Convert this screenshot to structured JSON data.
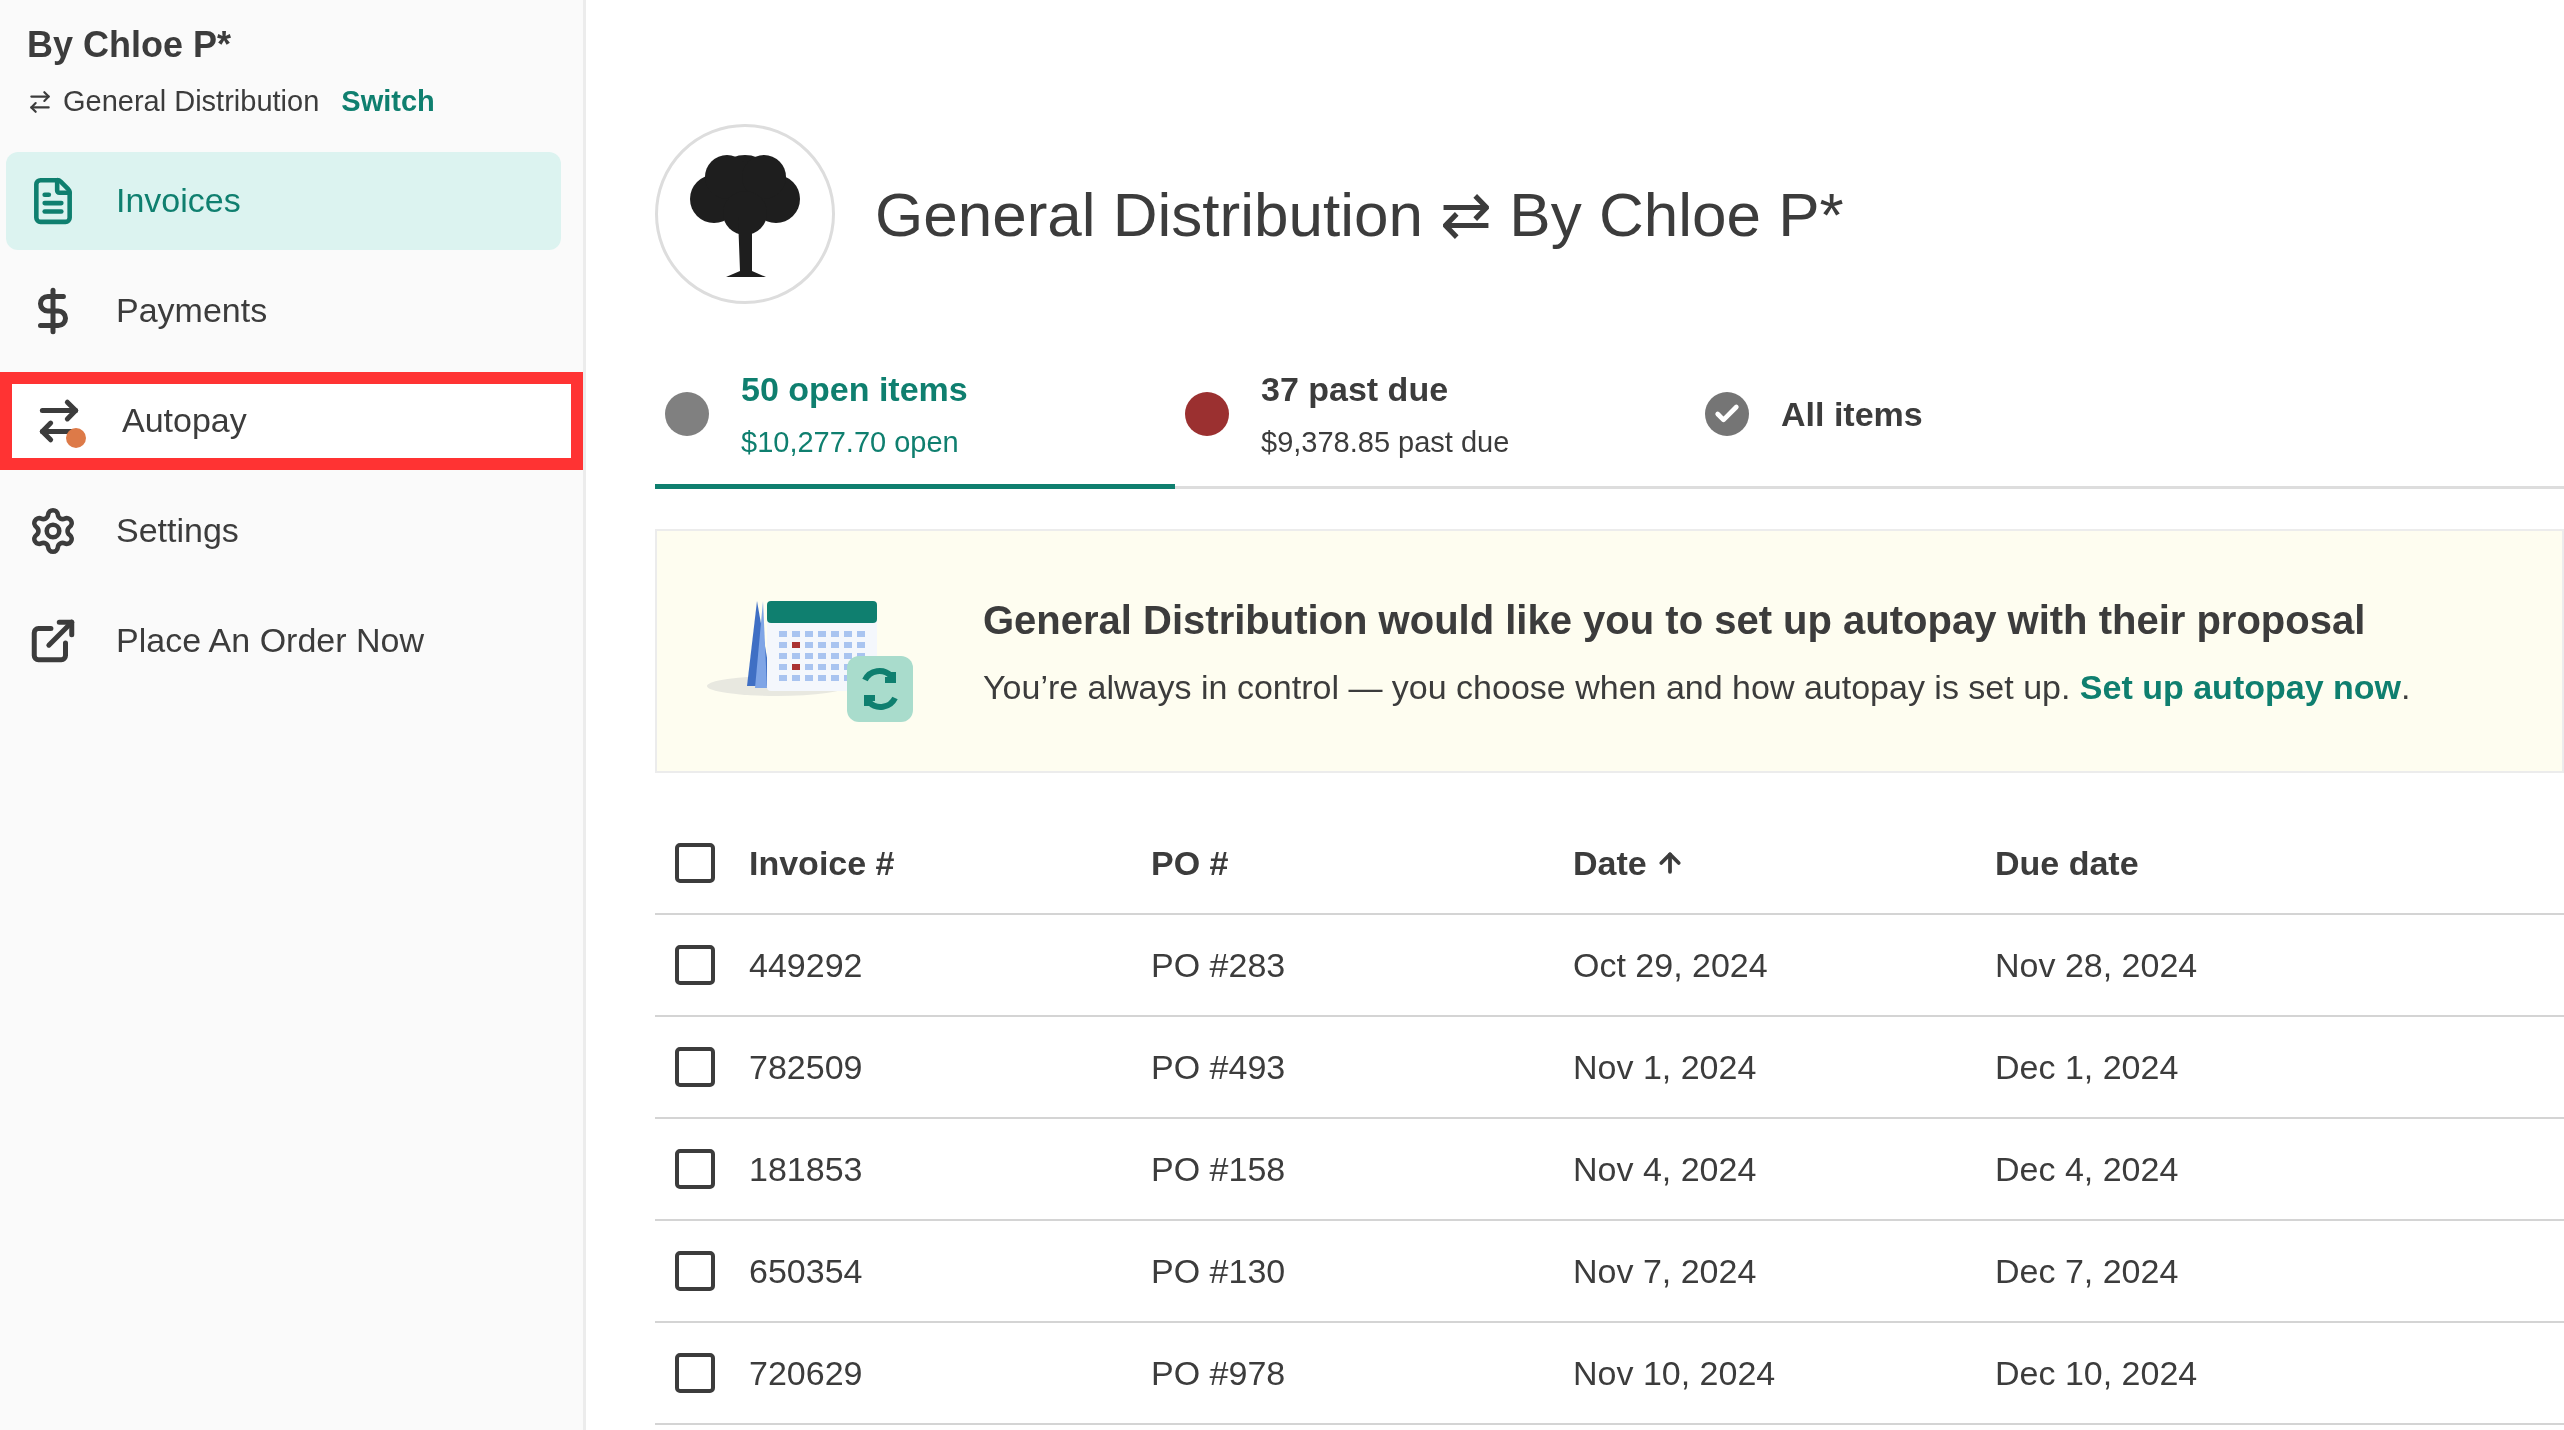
{
  "sidebar": {
    "title": "By Chloe P*",
    "subtitle": "General Distribution",
    "switch_link": "Switch",
    "items": [
      {
        "label": "Invoices",
        "selected": true,
        "highlighted": false,
        "badge": false
      },
      {
        "label": "Payments",
        "selected": false,
        "highlighted": false,
        "badge": false
      },
      {
        "label": "Autopay",
        "selected": false,
        "highlighted": true,
        "badge": true
      },
      {
        "label": "Settings",
        "selected": false,
        "highlighted": false,
        "badge": false
      },
      {
        "label": "Place An Order Now",
        "selected": false,
        "highlighted": false,
        "badge": false
      }
    ]
  },
  "header": {
    "title": "General Distribution ⇄ By Chloe P*"
  },
  "tabs": [
    {
      "kind": "dot",
      "color": "#808080",
      "title": "50 open items",
      "subtitle": "$10,277.70 open",
      "selected": true
    },
    {
      "kind": "dot",
      "color": "#9b3030",
      "title": "37 past due",
      "subtitle": "$9,378.85 past due",
      "selected": false
    },
    {
      "kind": "check",
      "title": "All items",
      "selected": false
    }
  ],
  "banner": {
    "title": "General Distribution would like you to set up autopay with their proposal",
    "text": "You’re always in control — you choose when and how autopay is set up.",
    "link": "Set up autopay now",
    "end": "."
  },
  "table": {
    "columns": [
      {
        "label": "Invoice #",
        "sorted": false
      },
      {
        "label": "PO #",
        "sorted": false
      },
      {
        "label": "Date",
        "sorted": true
      },
      {
        "label": "Due date",
        "sorted": false
      }
    ],
    "header_checked": false,
    "rows": [
      {
        "checked": false,
        "cells": [
          "449292",
          "PO #283",
          "Oct 29, 2024",
          "Nov 28, 2024"
        ]
      },
      {
        "checked": false,
        "cells": [
          "782509",
          "PO #493",
          "Nov 1, 2024",
          "Dec 1, 2024"
        ]
      },
      {
        "checked": false,
        "cells": [
          "181853",
          "PO #158",
          "Nov 4, 2024",
          "Dec 4, 2024"
        ]
      },
      {
        "checked": false,
        "cells": [
          "650354",
          "PO #130",
          "Nov 7, 2024",
          "Dec 7, 2024"
        ]
      },
      {
        "checked": false,
        "cells": [
          "720629",
          "PO #978",
          "Nov 10, 2024",
          "Dec 10, 2024"
        ]
      }
    ]
  }
}
